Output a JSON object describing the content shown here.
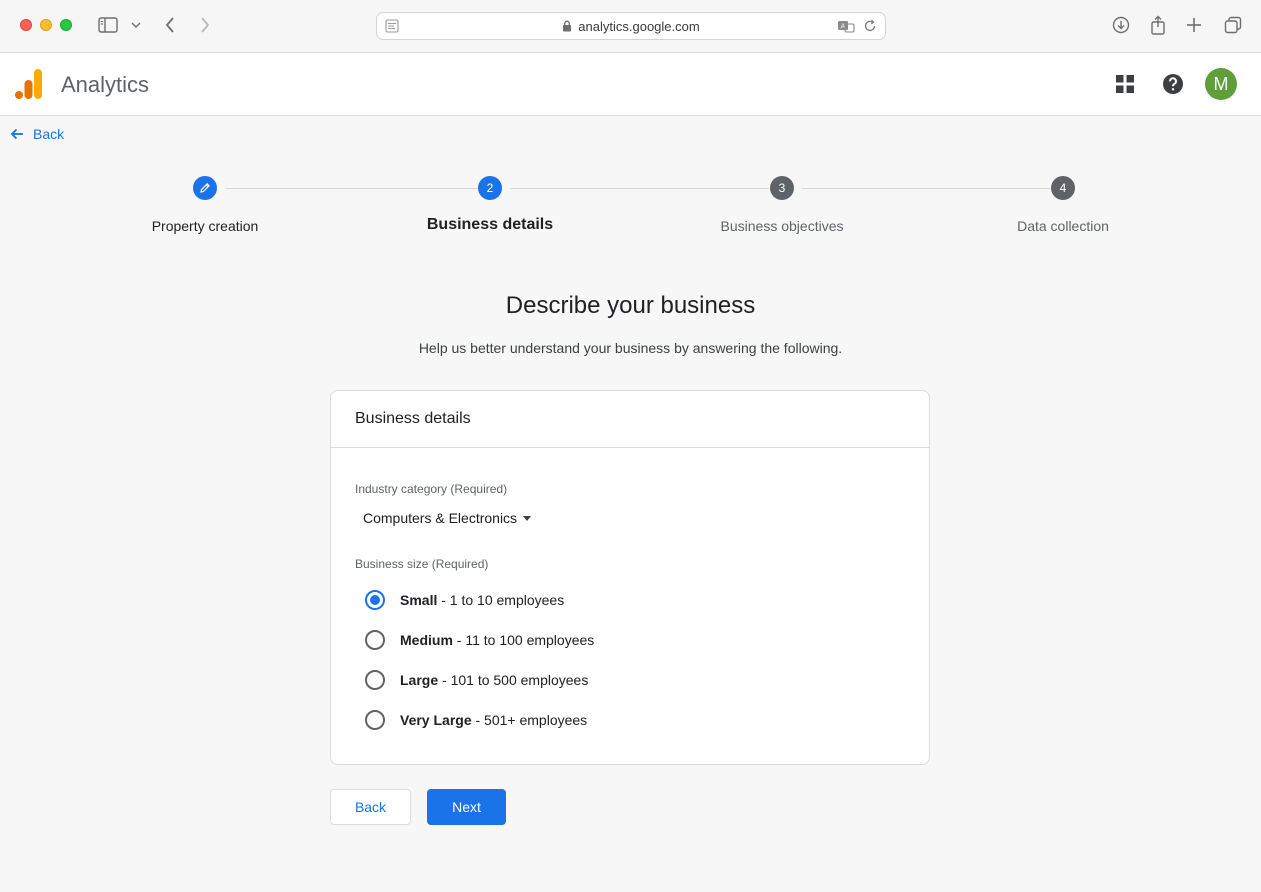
{
  "browser": {
    "url": "analytics.google.com",
    "icons": [
      "sidebar-toggle-icon",
      "chevron-down-icon",
      "back-arrow-icon",
      "forward-arrow-icon",
      "page-icon",
      "lock-icon",
      "translate-icon",
      "reload-icon",
      "download-icon",
      "share-icon",
      "new-tab-icon",
      "tabs-overview-icon"
    ]
  },
  "header": {
    "app_title": "Analytics",
    "avatar_initial": "M",
    "icons": [
      "apps-grid-icon",
      "help-icon"
    ]
  },
  "nav": {
    "back_label": "Back"
  },
  "stepper": {
    "steps": [
      {
        "number": "",
        "label": "Property creation",
        "state": "done"
      },
      {
        "number": "2",
        "label": "Business details",
        "state": "active"
      },
      {
        "number": "3",
        "label": "Business objectives",
        "state": "pending"
      },
      {
        "number": "4",
        "label": "Data collection",
        "state": "pending"
      }
    ]
  },
  "main": {
    "title": "Describe your business",
    "subtitle": "Help us better understand your business by answering the following."
  },
  "card": {
    "title": "Business details",
    "industry": {
      "label": "Industry category (Required)",
      "value": "Computers & Electronics"
    },
    "size": {
      "label": "Business size (Required)",
      "options": [
        {
          "name": "Small",
          "detail": " - 1 to 10 employees",
          "checked": true
        },
        {
          "name": "Medium",
          "detail": " - 11 to 100 employees",
          "checked": false
        },
        {
          "name": "Large",
          "detail": " - 101 to 500 employees",
          "checked": false
        },
        {
          "name": "Very Large",
          "detail": " - 501+ employees",
          "checked": false
        }
      ]
    }
  },
  "actions": {
    "back_label": "Back",
    "next_label": "Next"
  },
  "colors": {
    "accent": "#1a73e8",
    "avatar": "#5e9e3b",
    "pending_step": "#5f6368"
  }
}
